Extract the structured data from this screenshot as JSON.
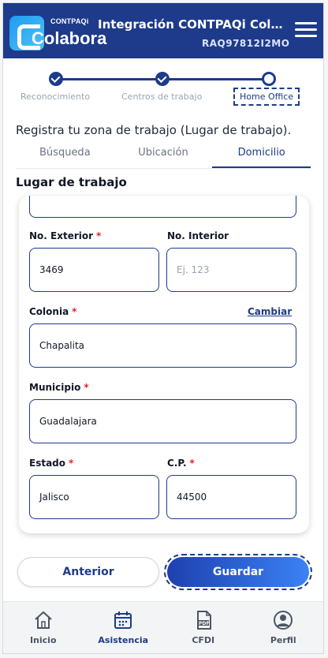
{
  "app": {
    "logo_small": "CONTPAQi",
    "logo_big": "Colabora",
    "title": "Integración CONTPAQi Colabo...",
    "subtitle": "RAQ97812I2MO"
  },
  "stepper": {
    "steps": [
      {
        "label": "Reconocimiento",
        "state": "done"
      },
      {
        "label": "Centros de trabajo",
        "state": "done"
      },
      {
        "label": "Home Office",
        "state": "current"
      }
    ]
  },
  "intro": "Registra tu zona de trabajo (Lugar de trabajo).",
  "tabs": [
    {
      "label": "Búsqueda"
    },
    {
      "label": "Ubicación"
    },
    {
      "label": "Domicilio",
      "active": true
    }
  ],
  "section_title": "Lugar de trabajo",
  "form": {
    "no_exterior": {
      "label": "No. Exterior",
      "required": "*",
      "value": "3469"
    },
    "no_interior": {
      "label": "No. Interior",
      "placeholder": "Ej. 123"
    },
    "colonia": {
      "label": "Colonia",
      "required": "*",
      "value": "Chapalita",
      "action": "Cambiar"
    },
    "municipio": {
      "label": "Municipio",
      "required": "*",
      "value": "Guadalajara"
    },
    "estado": {
      "label": "Estado",
      "required": "*",
      "value": "Jalisco"
    },
    "cp": {
      "label": "C.P.",
      "required": "*",
      "value": "44500"
    }
  },
  "buttons": {
    "prev": "Anterior",
    "save": "Guardar"
  },
  "nav": [
    {
      "label": "Inicio",
      "icon": "home-icon"
    },
    {
      "label": "Asistencia",
      "icon": "calendar-icon",
      "active": true
    },
    {
      "label": "CFDI",
      "icon": "pdf-icon"
    },
    {
      "label": "Perfil",
      "icon": "user-icon"
    }
  ],
  "colors": {
    "primary": "#1e3a8a",
    "accent": "#3b82f6",
    "required": "#dc2626"
  }
}
